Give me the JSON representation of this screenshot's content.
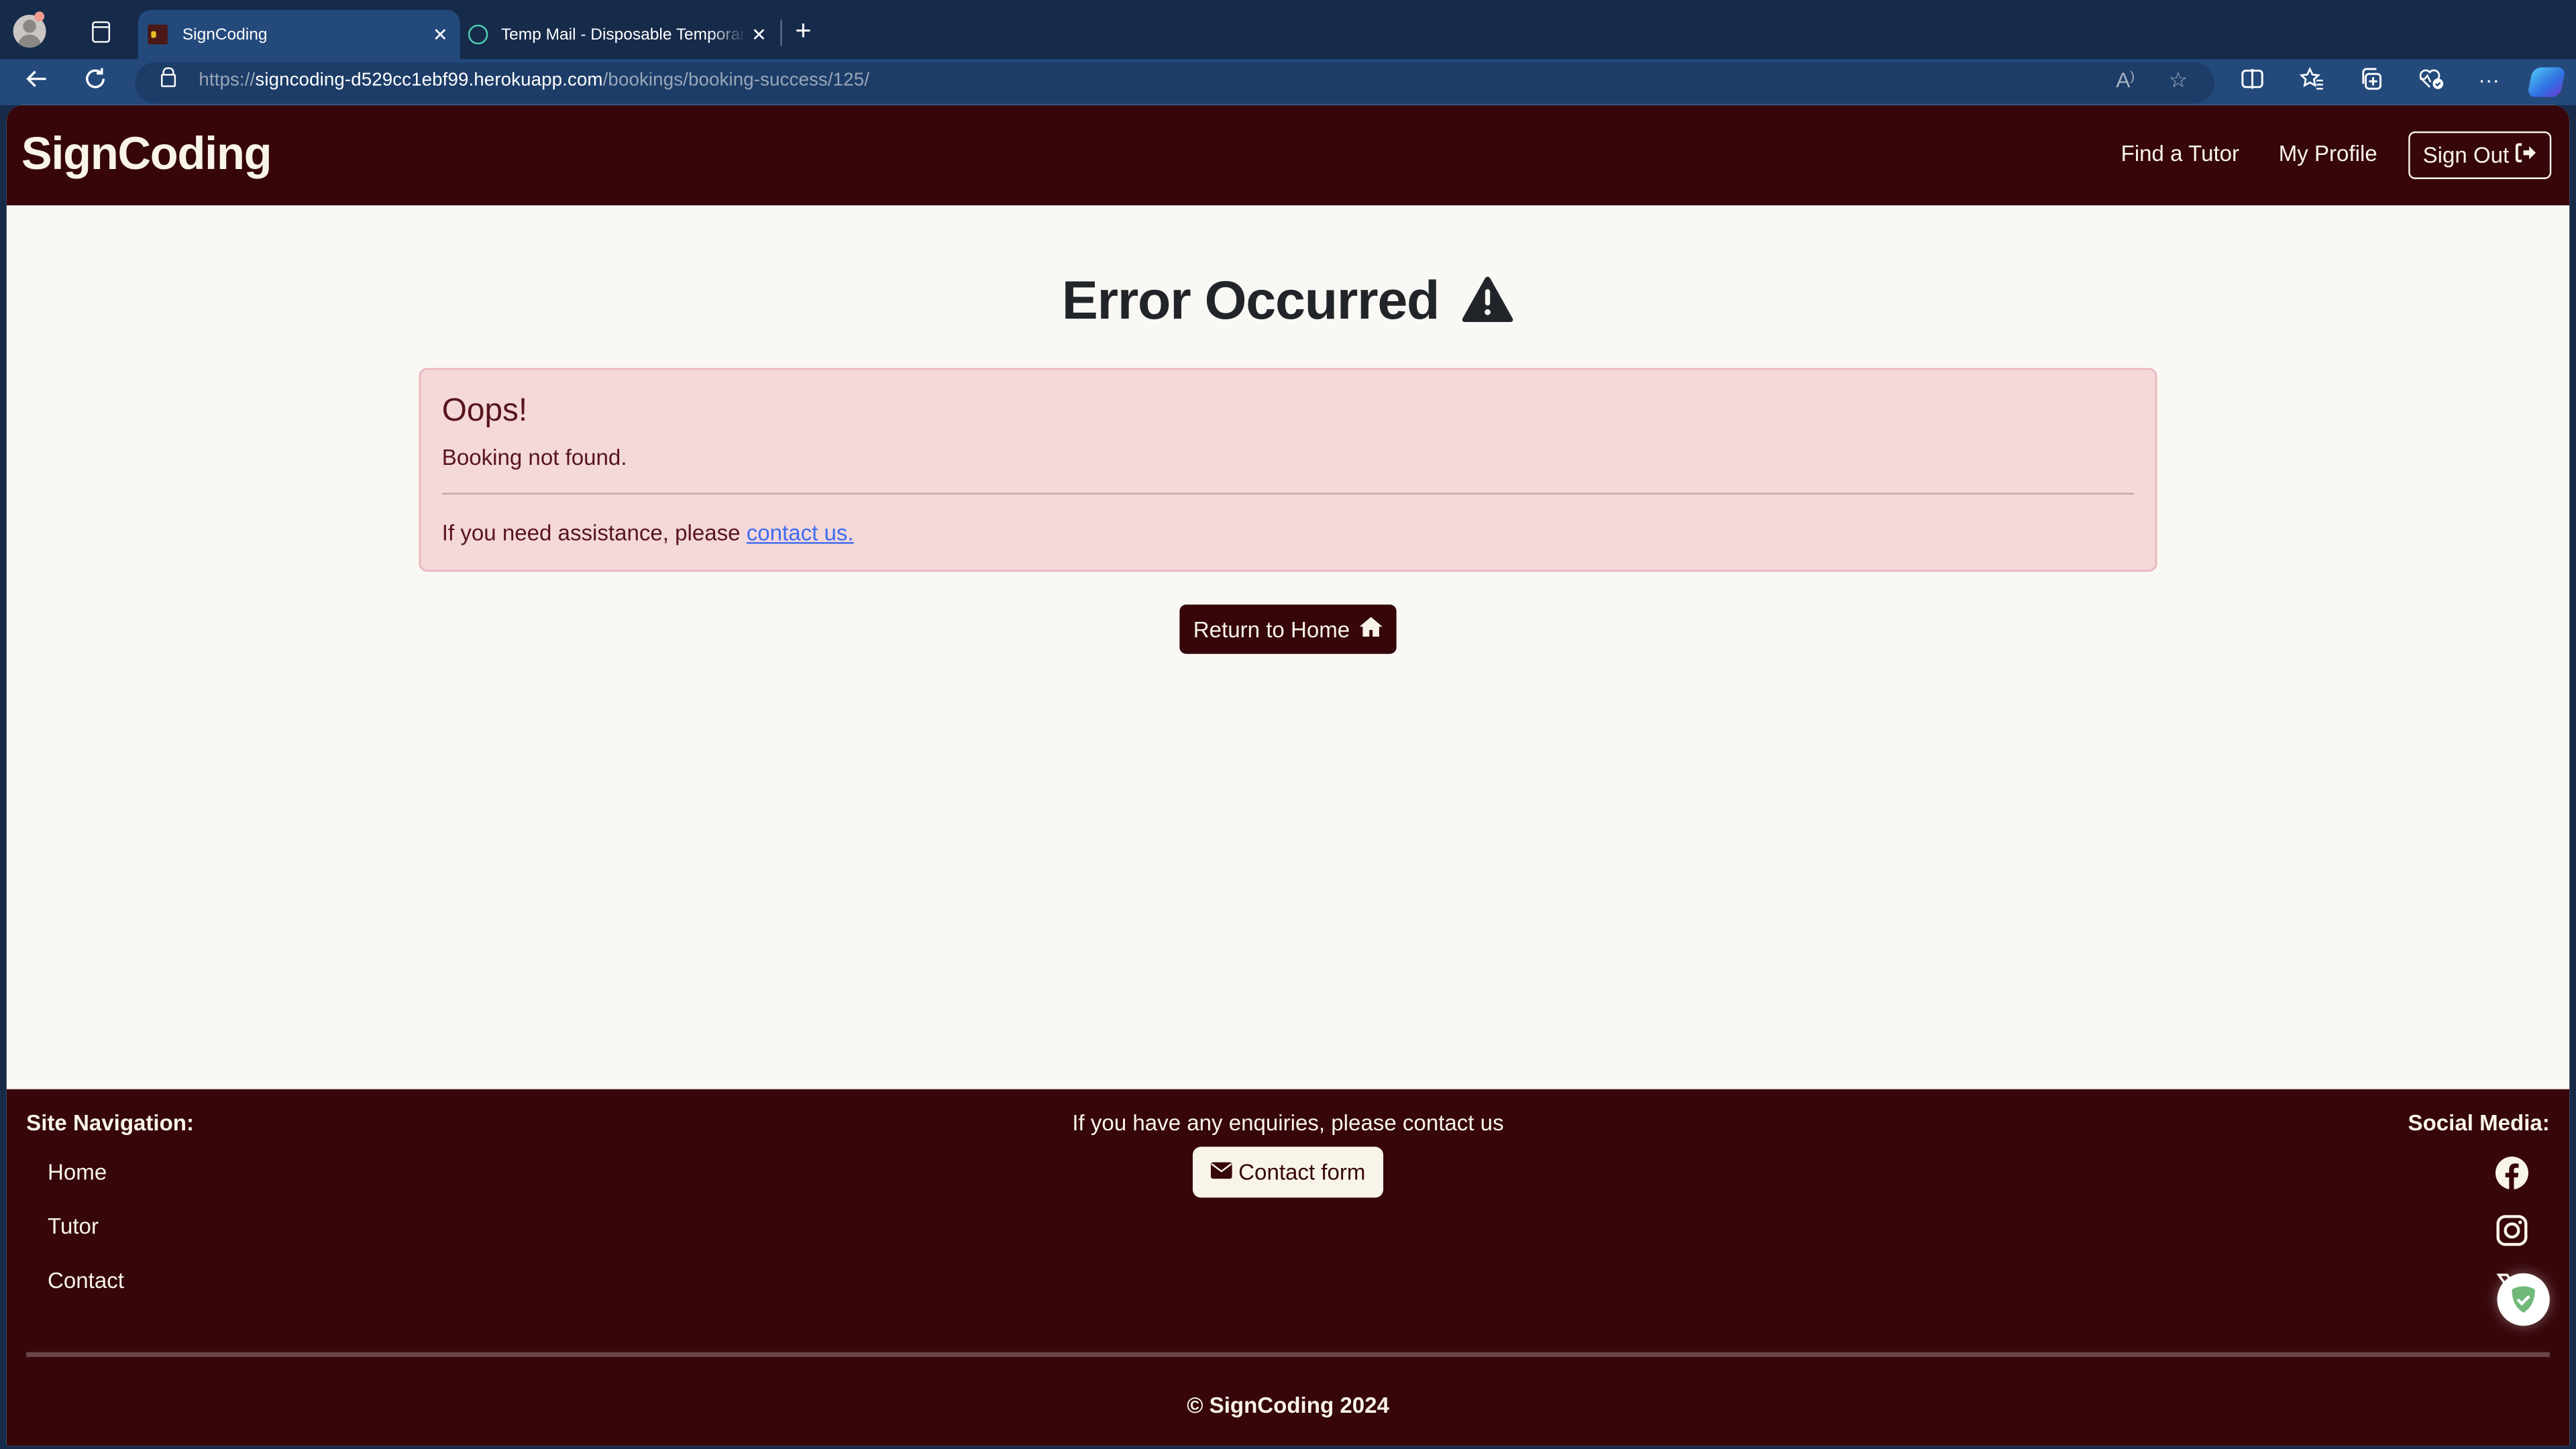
{
  "browser": {
    "tabs": [
      {
        "title": "SignCoding",
        "active": true,
        "favicon": "signcoding-favicon"
      },
      {
        "title": "Temp Mail - Disposable Temporary Email",
        "active": false,
        "favicon": "tempmail-favicon"
      }
    ],
    "close_glyph": "✕",
    "new_tab_glyph": "+",
    "url_scheme": "https://",
    "url_host": "signcoding-d529cc1ebf99.herokuapp.com",
    "url_path": "/bookings/booking-success/125/",
    "toolbar_icons": [
      "read-aloud-icon",
      "favorite-star-icon",
      "split-screen-icon",
      "favorites-icon",
      "collections-icon",
      "browser-essentials-icon",
      "more-icon",
      "copilot-icon"
    ]
  },
  "site": {
    "brand": "SignCoding",
    "nav": {
      "find_tutor": "Find a Tutor",
      "my_profile": "My Profile",
      "sign_out": "Sign Out"
    }
  },
  "main": {
    "title": "Error Occurred",
    "alert": {
      "heading": "Oops!",
      "message": "Booking not found.",
      "help_text": "If you need assistance, please ",
      "help_link": "contact us."
    },
    "return_home_label": "Return to Home"
  },
  "footer": {
    "site_nav_heading": "Site Navigation:",
    "site_nav_links": [
      "Home",
      "Tutor",
      "Contact"
    ],
    "enquiry_text": "If you have any enquiries, please contact us",
    "contact_button": "Contact form",
    "social_heading": "Social Media:",
    "social_links": [
      "facebook",
      "instagram",
      "x"
    ],
    "copyright": "© SignCoding 2024"
  },
  "colors": {
    "brand_maroon": "#36060a",
    "page_bg": "#f9f8f4",
    "alert_bg": "#f4d8da",
    "alert_text": "#58151c",
    "link_blue": "#3d6cf0",
    "browser_frame": "#162a4a",
    "browser_toolbar": "#244a7c"
  }
}
